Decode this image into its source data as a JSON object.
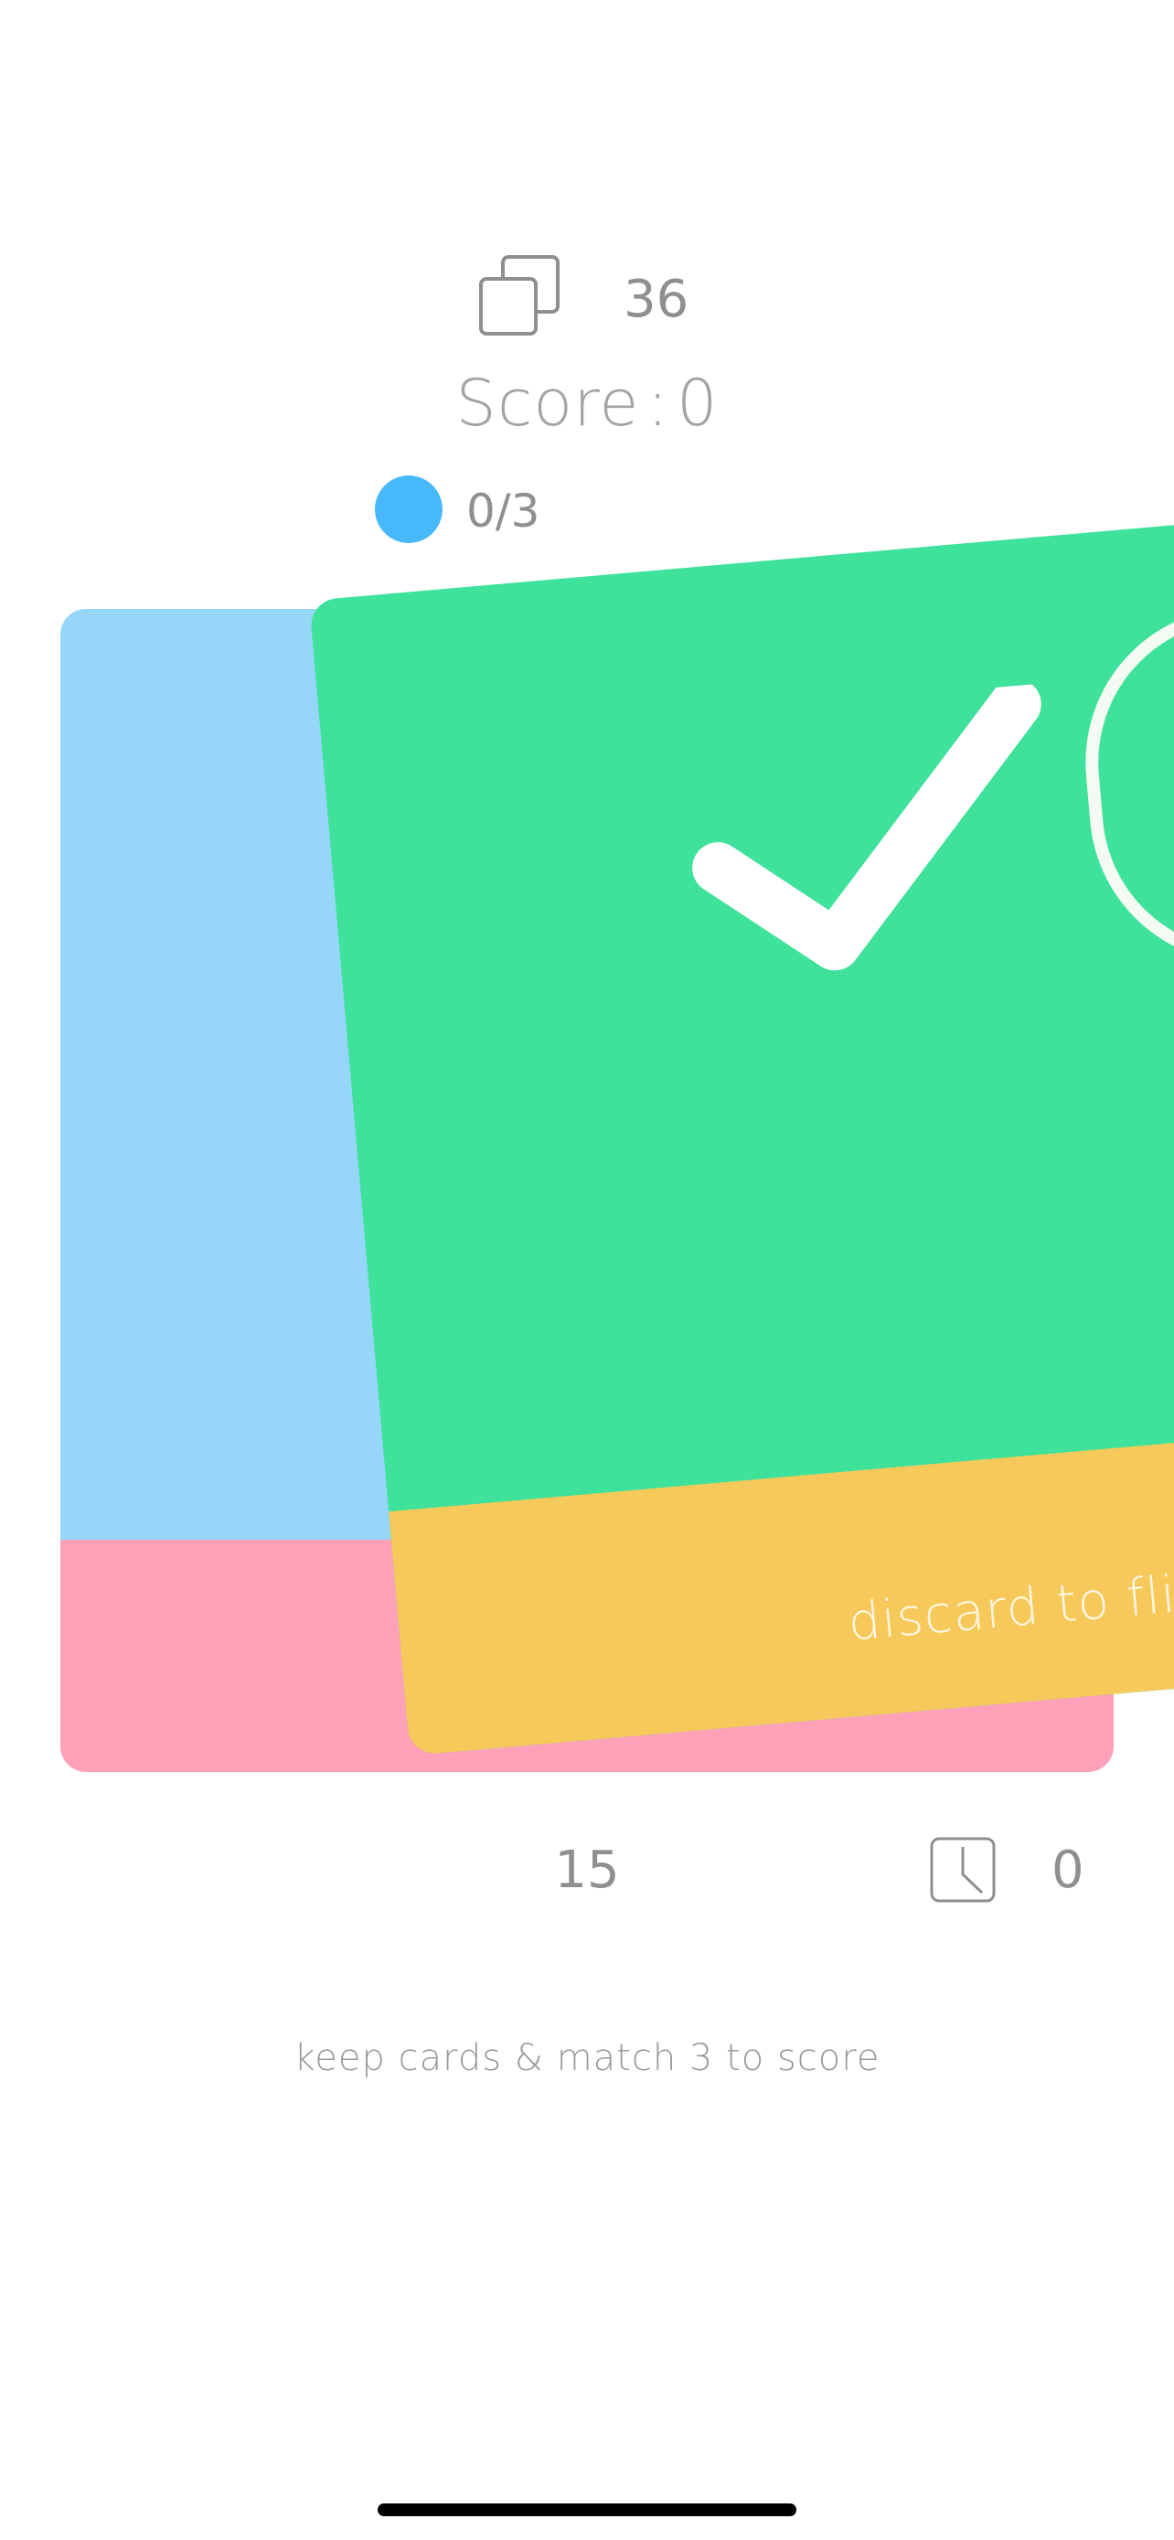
{
  "header": {
    "deck_count": "36",
    "score_label": "Score",
    "score_sep": ":",
    "score_value": "0",
    "progress": "0/3"
  },
  "card": {
    "front_label": "discard to flip",
    "back_accent_colors": [
      "#96d6f9",
      "#ffa2b9"
    ],
    "front_colors": [
      "#3ee29a",
      "#f7c95b"
    ]
  },
  "footer": {
    "count": "15",
    "timer_value": "0",
    "hint": "keep cards & match 3 to score"
  },
  "icons": {
    "deck": "stacked-cards-icon",
    "timer": "clock-icon",
    "check": "checkmark-icon"
  },
  "colors": {
    "progress_dot": "#47b9fb",
    "text": "#8f8f8f"
  }
}
